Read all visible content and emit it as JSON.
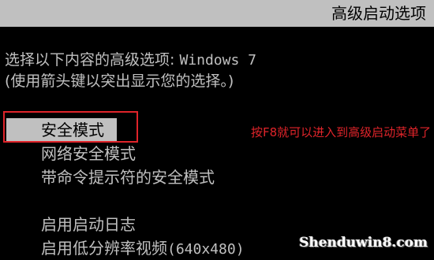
{
  "title_bar": {
    "title": "高级启动选项"
  },
  "prompt": {
    "line1_prefix": "选择以下内容的高级选项: ",
    "line1_os": "Windows 7",
    "line2": "(使用箭头键以突出显示您的选择。)"
  },
  "menu": {
    "items": [
      {
        "label": "安全模式",
        "selected": true
      },
      {
        "label": "网络安全模式"
      },
      {
        "label": "带命令提示符的安全模式"
      },
      {
        "label": "启用启动日志"
      },
      {
        "label_prefix": "启用低分辨率视频",
        "label_suffix": "(640x480)"
      }
    ]
  },
  "annotation": {
    "text": "按F8就可以进入到高级启动菜单了"
  },
  "watermark": {
    "text": "Shenduwin8.com"
  },
  "colors": {
    "background": "#000000",
    "text": "#c0c0c0",
    "selection_bg": "#c0c0c0",
    "annotation_red": "#e0242a"
  }
}
